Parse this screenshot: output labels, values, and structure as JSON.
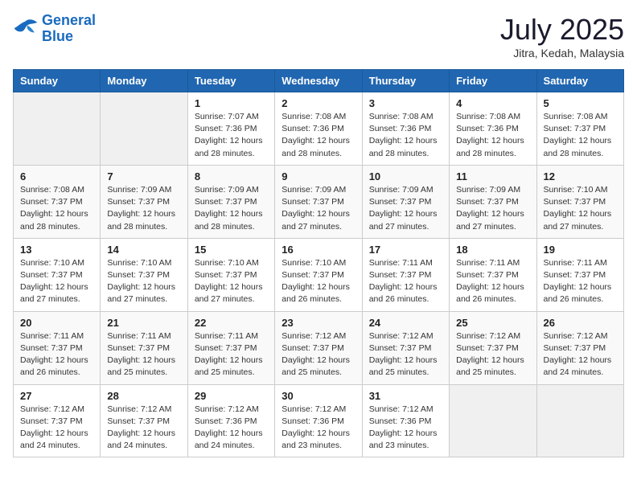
{
  "logo": {
    "line1": "General",
    "line2": "Blue"
  },
  "title": "July 2025",
  "subtitle": "Jitra, Kedah, Malaysia",
  "weekdays": [
    "Sunday",
    "Monday",
    "Tuesday",
    "Wednesday",
    "Thursday",
    "Friday",
    "Saturday"
  ],
  "weeks": [
    [
      {
        "day": "",
        "info": ""
      },
      {
        "day": "",
        "info": ""
      },
      {
        "day": "1",
        "info": "Sunrise: 7:07 AM\nSunset: 7:36 PM\nDaylight: 12 hours and 28 minutes."
      },
      {
        "day": "2",
        "info": "Sunrise: 7:08 AM\nSunset: 7:36 PM\nDaylight: 12 hours and 28 minutes."
      },
      {
        "day": "3",
        "info": "Sunrise: 7:08 AM\nSunset: 7:36 PM\nDaylight: 12 hours and 28 minutes."
      },
      {
        "day": "4",
        "info": "Sunrise: 7:08 AM\nSunset: 7:36 PM\nDaylight: 12 hours and 28 minutes."
      },
      {
        "day": "5",
        "info": "Sunrise: 7:08 AM\nSunset: 7:37 PM\nDaylight: 12 hours and 28 minutes."
      }
    ],
    [
      {
        "day": "6",
        "info": "Sunrise: 7:08 AM\nSunset: 7:37 PM\nDaylight: 12 hours and 28 minutes."
      },
      {
        "day": "7",
        "info": "Sunrise: 7:09 AM\nSunset: 7:37 PM\nDaylight: 12 hours and 28 minutes."
      },
      {
        "day": "8",
        "info": "Sunrise: 7:09 AM\nSunset: 7:37 PM\nDaylight: 12 hours and 28 minutes."
      },
      {
        "day": "9",
        "info": "Sunrise: 7:09 AM\nSunset: 7:37 PM\nDaylight: 12 hours and 27 minutes."
      },
      {
        "day": "10",
        "info": "Sunrise: 7:09 AM\nSunset: 7:37 PM\nDaylight: 12 hours and 27 minutes."
      },
      {
        "day": "11",
        "info": "Sunrise: 7:09 AM\nSunset: 7:37 PM\nDaylight: 12 hours and 27 minutes."
      },
      {
        "day": "12",
        "info": "Sunrise: 7:10 AM\nSunset: 7:37 PM\nDaylight: 12 hours and 27 minutes."
      }
    ],
    [
      {
        "day": "13",
        "info": "Sunrise: 7:10 AM\nSunset: 7:37 PM\nDaylight: 12 hours and 27 minutes."
      },
      {
        "day": "14",
        "info": "Sunrise: 7:10 AM\nSunset: 7:37 PM\nDaylight: 12 hours and 27 minutes."
      },
      {
        "day": "15",
        "info": "Sunrise: 7:10 AM\nSunset: 7:37 PM\nDaylight: 12 hours and 27 minutes."
      },
      {
        "day": "16",
        "info": "Sunrise: 7:10 AM\nSunset: 7:37 PM\nDaylight: 12 hours and 26 minutes."
      },
      {
        "day": "17",
        "info": "Sunrise: 7:11 AM\nSunset: 7:37 PM\nDaylight: 12 hours and 26 minutes."
      },
      {
        "day": "18",
        "info": "Sunrise: 7:11 AM\nSunset: 7:37 PM\nDaylight: 12 hours and 26 minutes."
      },
      {
        "day": "19",
        "info": "Sunrise: 7:11 AM\nSunset: 7:37 PM\nDaylight: 12 hours and 26 minutes."
      }
    ],
    [
      {
        "day": "20",
        "info": "Sunrise: 7:11 AM\nSunset: 7:37 PM\nDaylight: 12 hours and 26 minutes."
      },
      {
        "day": "21",
        "info": "Sunrise: 7:11 AM\nSunset: 7:37 PM\nDaylight: 12 hours and 25 minutes."
      },
      {
        "day": "22",
        "info": "Sunrise: 7:11 AM\nSunset: 7:37 PM\nDaylight: 12 hours and 25 minutes."
      },
      {
        "day": "23",
        "info": "Sunrise: 7:12 AM\nSunset: 7:37 PM\nDaylight: 12 hours and 25 minutes."
      },
      {
        "day": "24",
        "info": "Sunrise: 7:12 AM\nSunset: 7:37 PM\nDaylight: 12 hours and 25 minutes."
      },
      {
        "day": "25",
        "info": "Sunrise: 7:12 AM\nSunset: 7:37 PM\nDaylight: 12 hours and 25 minutes."
      },
      {
        "day": "26",
        "info": "Sunrise: 7:12 AM\nSunset: 7:37 PM\nDaylight: 12 hours and 24 minutes."
      }
    ],
    [
      {
        "day": "27",
        "info": "Sunrise: 7:12 AM\nSunset: 7:37 PM\nDaylight: 12 hours and 24 minutes."
      },
      {
        "day": "28",
        "info": "Sunrise: 7:12 AM\nSunset: 7:37 PM\nDaylight: 12 hours and 24 minutes."
      },
      {
        "day": "29",
        "info": "Sunrise: 7:12 AM\nSunset: 7:36 PM\nDaylight: 12 hours and 24 minutes."
      },
      {
        "day": "30",
        "info": "Sunrise: 7:12 AM\nSunset: 7:36 PM\nDaylight: 12 hours and 23 minutes."
      },
      {
        "day": "31",
        "info": "Sunrise: 7:12 AM\nSunset: 7:36 PM\nDaylight: 12 hours and 23 minutes."
      },
      {
        "day": "",
        "info": ""
      },
      {
        "day": "",
        "info": ""
      }
    ]
  ]
}
